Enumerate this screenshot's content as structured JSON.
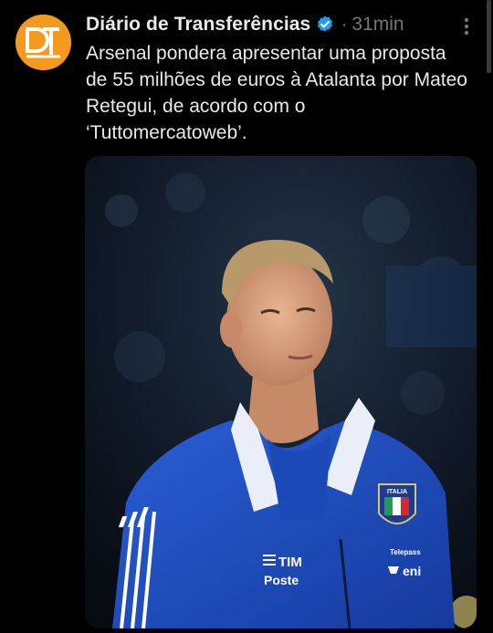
{
  "tweet": {
    "author_name": "Diário de Transferências",
    "separator": "·",
    "timestamp": "31min",
    "text": "Arsenal pondera apresentar uma proposta de 55 milhões de euros à Atalanta por Mateo Retegui, de acordo com o ‘Tuttomercatoweb’.",
    "avatar_icon": "dt-logo-icon",
    "verified_icon": "verified-badge-icon",
    "more_icon": "more-options-icon"
  },
  "media": {
    "jersey_sponsor_1": "TIM",
    "jersey_sponsor_2": "Poste",
    "jersey_crest": "ITALIA",
    "jersey_sponsor_3": "Telepass",
    "jersey_sponsor_4": "eni"
  },
  "colors": {
    "background": "#000000",
    "text_primary": "#e7e9ea",
    "text_secondary": "#71767b",
    "verified": "#1d9bf0",
    "avatar_bg": "#f39a1f",
    "jacket_blue": "#1f4fc4"
  }
}
